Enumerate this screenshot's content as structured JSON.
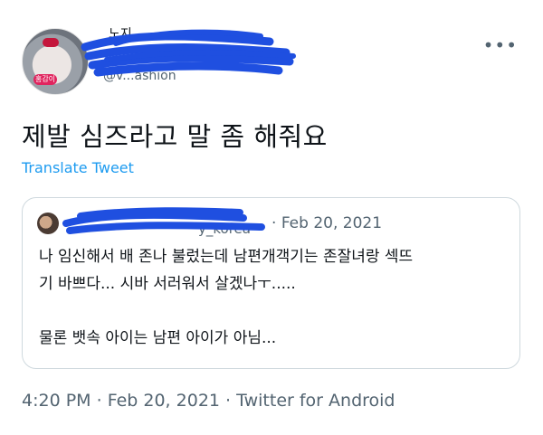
{
  "tweet": {
    "text": "제발 심즈라고 말 좀 해줘요",
    "translate_label": "Translate Tweet",
    "more_label": "•••",
    "avatar_badge": "홍감이",
    "author_partial": "노지",
    "handle_partial": "@v...ashion"
  },
  "quote": {
    "handle_partial": "y_korea",
    "separator": "·",
    "date": "Feb 20, 2021",
    "lines": [
      "나 임신해서 배 존나 불렀는데 남편개객기는 존잘녀랑 섹뜨",
      "기 바쁘다... 시바 서러워서 살겠나ㅜ.....",
      "물론 뱃속 아이는 남편 아이가 아님..."
    ]
  },
  "footer": {
    "time": "4:20 PM",
    "sep1": "·",
    "date": "Feb 20, 2021",
    "sep2": "·",
    "source": "Twitter for Android"
  },
  "colors": {
    "accent": "#1d9bf0",
    "secondary_text": "#536471",
    "redaction": "#1f4fe0",
    "border": "#cfd9de"
  }
}
